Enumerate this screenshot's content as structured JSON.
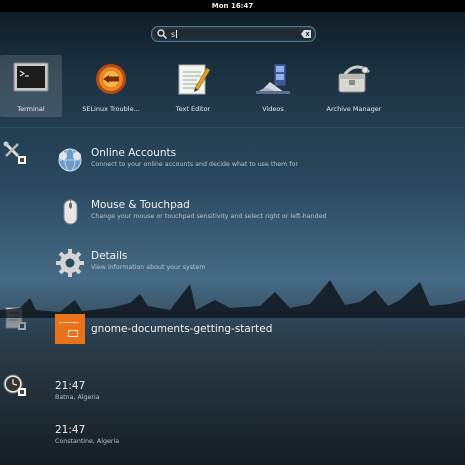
{
  "topbar": {
    "clock": "Mon 16:47"
  },
  "search": {
    "query": "s"
  },
  "apps": [
    {
      "label": "Terminal",
      "icon": "terminal-icon",
      "selected": true
    },
    {
      "label": "SELinux Trouble...",
      "icon": "selinux-troubleshooter-icon",
      "selected": false
    },
    {
      "label": "Text Editor",
      "icon": "text-editor-icon",
      "selected": false
    },
    {
      "label": "Videos",
      "icon": "videos-icon",
      "selected": false
    },
    {
      "label": "Archive Manager",
      "icon": "archive-manager-icon",
      "selected": false
    }
  ],
  "settings_results": [
    {
      "title": "Online Accounts",
      "description": "Connect to your online accounts and decide what to use them for",
      "icon": "online-accounts-icon"
    },
    {
      "title": "Mouse & Touchpad",
      "description": "Change your mouse or touchpad sensitivity and select right or left-handed",
      "icon": "mouse-icon"
    },
    {
      "title": "Details",
      "description": "View information about your system",
      "icon": "gear-icon"
    }
  ],
  "document_results": [
    {
      "title": "gnome-documents-getting-started",
      "icon": "document-thumbnail"
    }
  ],
  "clock_results": [
    {
      "time": "21:47",
      "city": "Batna, Algeria"
    },
    {
      "time": "21:47",
      "city": "Constantine, Algeria"
    }
  ],
  "providers": [
    "settings-provider-icon",
    "documents-provider-icon",
    "clocks-provider-icon"
  ],
  "colors": {
    "accent": "#4e7893",
    "document_thumb": "#e8731c",
    "topbar": "#000000"
  }
}
